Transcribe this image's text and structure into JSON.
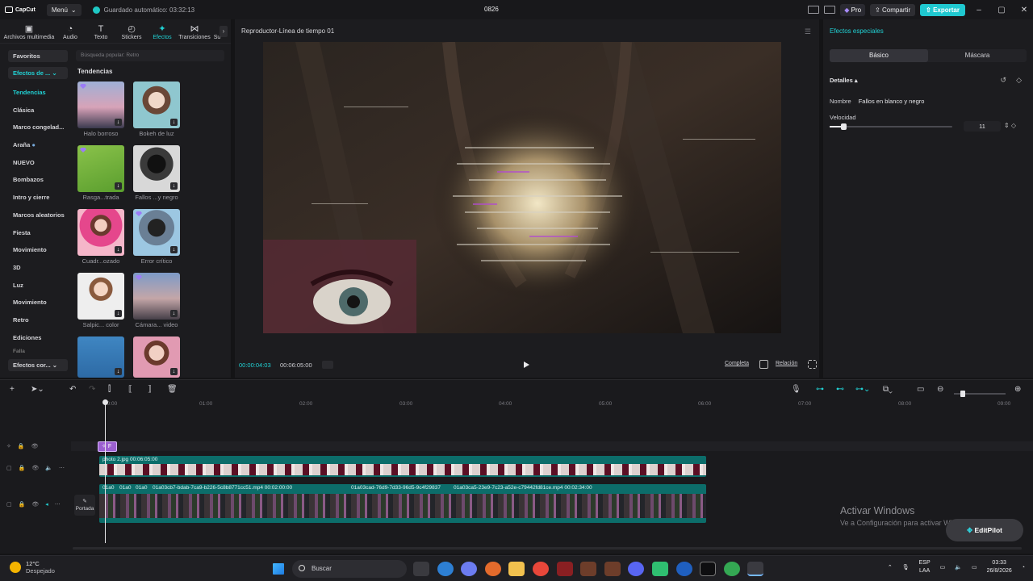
{
  "titlebar": {
    "app_name": "CapCut",
    "menu_label": "Menú",
    "autosave": "Guardado automático: 03:32:13",
    "project_name": "0826",
    "pro_label": "Pro",
    "share_label": "Compartir",
    "export_label": "Exportar"
  },
  "toolbar": {
    "tabs": [
      {
        "label": "Archivos multimedia",
        "icon": "media-icon"
      },
      {
        "label": "Audio",
        "icon": "audio-icon"
      },
      {
        "label": "Texto",
        "icon": "text-icon"
      },
      {
        "label": "Stickers",
        "icon": "sticker-icon"
      },
      {
        "label": "Efectos",
        "icon": "effects-icon"
      },
      {
        "label": "Transiciones",
        "icon": "transitions-icon"
      },
      {
        "label": "Su",
        "icon": ""
      }
    ]
  },
  "categories": {
    "favorites": "Favoritos",
    "dropdown": "Efectos de ...",
    "items": [
      "Tendencias",
      "Clásica",
      "Marco congelad...",
      "Araña",
      "NUEVO",
      "Bombazos",
      "Intro y cierre",
      "Marcos aleatorios",
      "Fiesta",
      "Movimiento",
      "3D",
      "Luz",
      "Movimiento",
      "Retro",
      "Ediciones",
      "Falla"
    ],
    "bottom_dropdown": "Efectos cor..."
  },
  "search": {
    "placeholder": "Búsqueda popular: Retro"
  },
  "effects_section": {
    "heading": "Tendencias",
    "items": [
      {
        "label": "Halo borroso"
      },
      {
        "label": "Bokeh de luz"
      },
      {
        "label": "Rasga...trada"
      },
      {
        "label": "Fallos ...y negro"
      },
      {
        "label": "Cuadr...ozado"
      },
      {
        "label": "Error crítico"
      },
      {
        "label": "Salpic... color"
      },
      {
        "label": "Cámara... video"
      },
      {
        "label": ""
      },
      {
        "label": ""
      }
    ]
  },
  "player": {
    "title": "Reproductor-Línea de tiempo 01",
    "current_time": "00:00:04:03",
    "total_time": "00:06:05:00",
    "full_label": "Completa",
    "ratio_label": "Relación"
  },
  "inspector": {
    "title": "Efectos especiales",
    "tabs": [
      "Básico",
      "Máscara"
    ],
    "details_label": "Detalles",
    "name_label": "Nombre",
    "name_value": "Fallos en blanco y negro",
    "speed_label": "Velocidad",
    "speed_value": "11",
    "speed_level": 0.11
  },
  "timeline": {
    "ruler": [
      "00:00",
      "01:00",
      "02:00",
      "03:00",
      "04:00",
      "05:00",
      "06:00",
      "07:00",
      "08:00",
      "09:00"
    ],
    "effect_clip_label": "F",
    "overlay_clip_caption": "photo 2.jpg  00:06:05:00",
    "main_clips": [
      {
        "caption": "01a0"
      },
      {
        "caption": "01a0"
      },
      {
        "caption": "01a0"
      },
      {
        "caption": "01a03cb7-bdab-7ca9-b226-5c8b8771cc51.mp4  00:02:00:00"
      },
      {
        "caption": "01a03cad-76d9-7d33-96d5-9c4f29837"
      },
      {
        "caption": "01a03ca5-23e9-7c23-a52e-c79442fd81ce.mp4  00:02:34:00"
      }
    ],
    "cover_label": "Portada"
  },
  "watermark": {
    "line1": "Activar Windows",
    "line2": "Ve a Configuración para activar Windows."
  },
  "editpilot_label": "EditPilot",
  "taskbar": {
    "temperature": "12°C",
    "weather": "Despejado",
    "search_placeholder": "Buscar",
    "lang_top": "ESP",
    "lang_bottom": "LAA",
    "time": "03:33",
    "date": "26/8/2026"
  }
}
